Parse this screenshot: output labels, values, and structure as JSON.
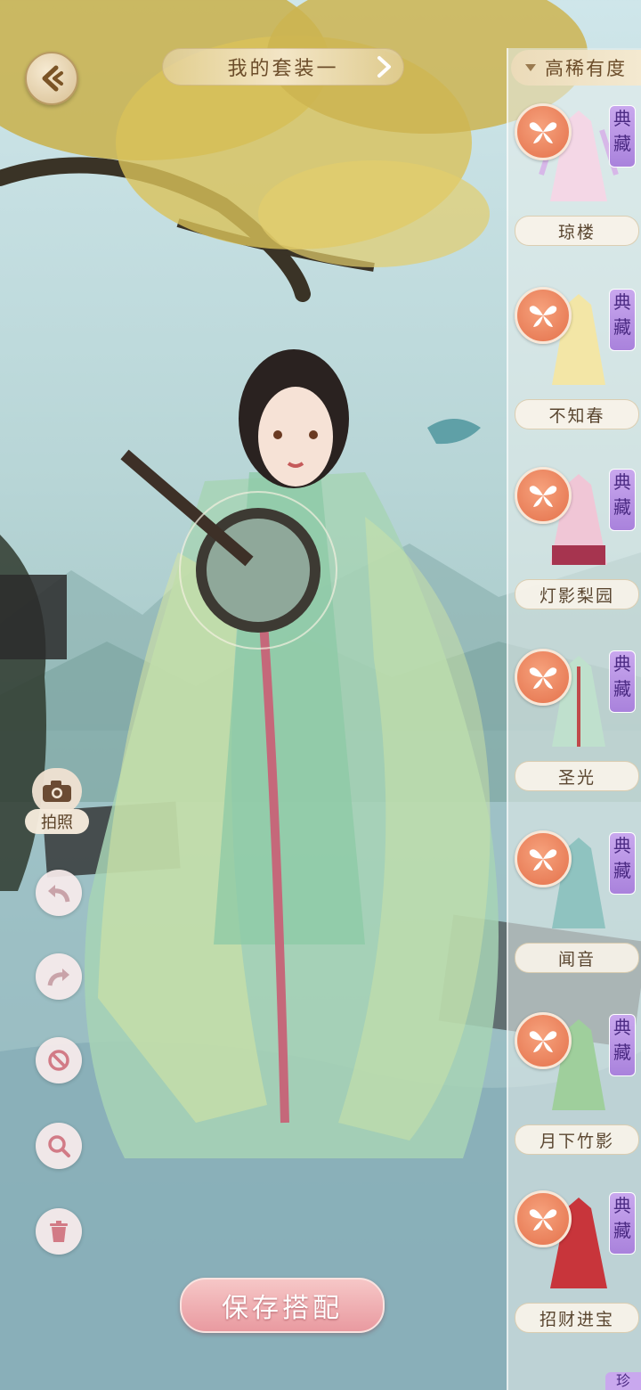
{
  "header": {
    "outfit_title": "我的套装一",
    "sort_label": "高稀有度"
  },
  "outfits": [
    {
      "name": "琼楼",
      "tag": "典藏"
    },
    {
      "name": "不知春",
      "tag": "典藏"
    },
    {
      "name": "灯影梨园",
      "tag": "典藏"
    },
    {
      "name": "圣光",
      "tag": "典藏"
    },
    {
      "name": "闻音",
      "tag": "典藏"
    },
    {
      "name": "月下竹影",
      "tag": "典藏"
    },
    {
      "name": "招财进宝",
      "tag": "典藏"
    }
  ],
  "tools": {
    "photo_label": "拍照"
  },
  "save_label": "保存搭配",
  "partial_tag": "珍",
  "colors": {
    "accent_gold": "#d8bf92",
    "badge_orange": "#e4714b",
    "tag_purple": "#a982dc",
    "save_pink": "#e99aa0"
  },
  "icons": [
    "back-arrow-icon",
    "next-chevron-icon",
    "butterfly-icon",
    "camera-icon",
    "undo-icon",
    "redo-icon",
    "forbid-icon",
    "zoom-icon",
    "trash-icon"
  ]
}
